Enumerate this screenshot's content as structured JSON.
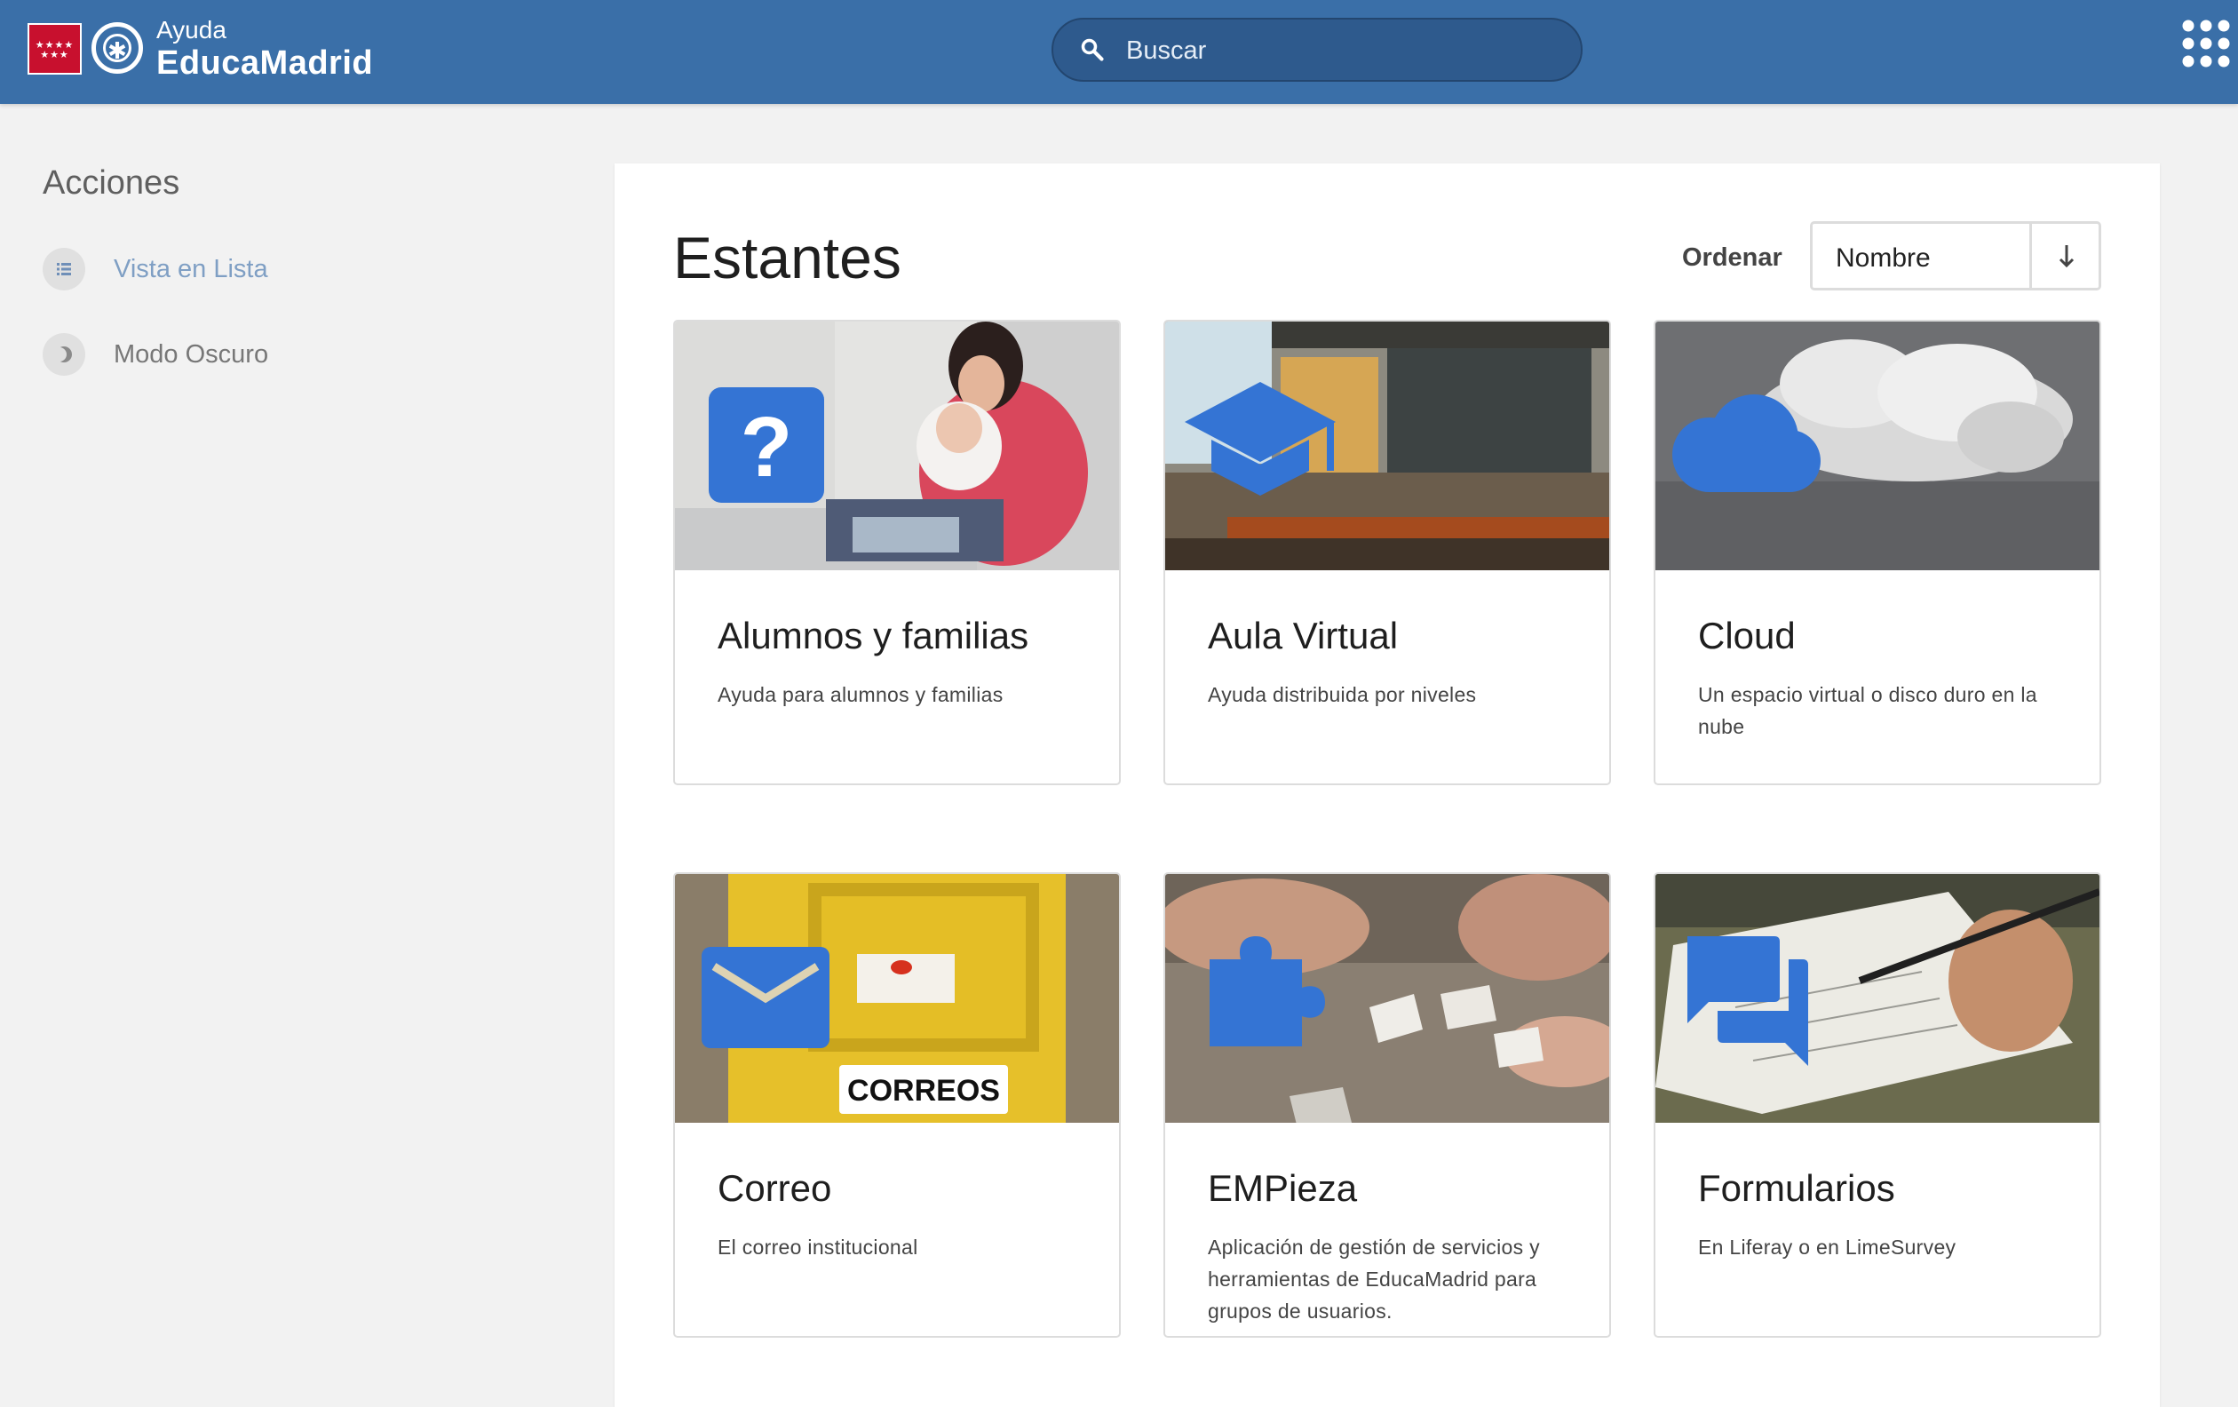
{
  "header": {
    "logo_small": "Ayuda",
    "logo_big": "EducaMadrid",
    "flag_stars": "★★★★\n★★★",
    "search_placeholder": "Buscar"
  },
  "sidebar": {
    "title": "Acciones",
    "items": [
      {
        "label": "Vista en Lista",
        "icon": "list-icon"
      },
      {
        "label": "Modo Oscuro",
        "icon": "moon-icon"
      }
    ]
  },
  "main": {
    "title": "Estantes",
    "sort_label": "Ordenar",
    "sort_value": "Nombre",
    "cards": [
      {
        "title": "Alumnos y familias",
        "description": "Ayuda para alumnos y familias",
        "icon": "question-icon"
      },
      {
        "title": "Aula Virtual",
        "description": "Ayuda distribuida por niveles",
        "icon": "graduation-cap-icon"
      },
      {
        "title": "Cloud",
        "description": "Un espacio virtual o disco duro en la nube",
        "icon": "cloud-icon"
      },
      {
        "title": "Correo",
        "description": "El correo institucional",
        "icon": "envelope-icon"
      },
      {
        "title": "EMPieza",
        "description": "Aplicación de gestión de servicios y herramientas de EducaMadrid para grupos de usuarios.",
        "icon": "puzzle-icon"
      },
      {
        "title": "Formularios",
        "description": "En Liferay o en LimeSurvey",
        "icon": "chat-icon"
      }
    ],
    "mailbox_sign": "CORREOS"
  },
  "colors": {
    "header_bg": "#3a6fa8",
    "accent_icon": "#3474d4",
    "page_bg": "#f2f2f2"
  }
}
